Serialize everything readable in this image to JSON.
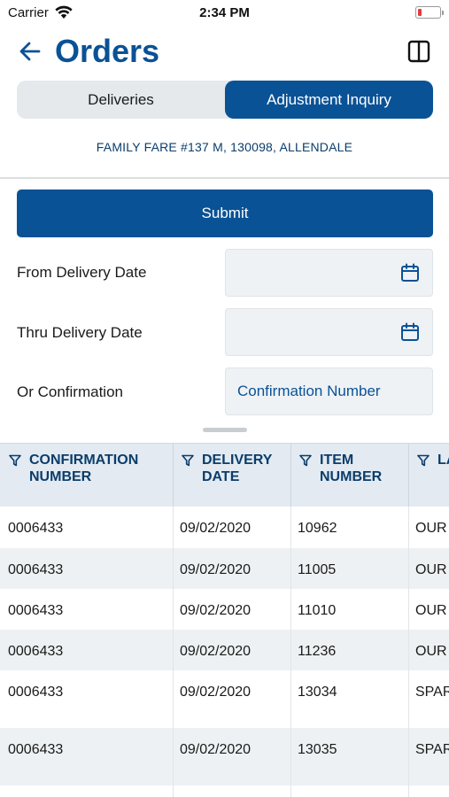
{
  "status_bar": {
    "carrier": "Carrier",
    "time": "2:34 PM"
  },
  "header": {
    "title": "Orders"
  },
  "tabs": [
    {
      "label": "Deliveries",
      "selected": false
    },
    {
      "label": "Adjustment Inquiry",
      "selected": true
    }
  ],
  "store": "FAMILY FARE #137 M, 130098, ALLENDALE",
  "form": {
    "submit_label": "Submit",
    "from_label": "From Delivery Date",
    "thru_label": "Thru Delivery Date",
    "confirmation_label": "Or Confirmation",
    "confirmation_placeholder": "Confirmation Number"
  },
  "table": {
    "columns": [
      "CONFIRMATION NUMBER",
      "DELIVERY DATE",
      "ITEM NUMBER",
      "LA"
    ],
    "column_lines": [
      [
        "CONFIRMATION",
        "NUMBER"
      ],
      [
        "DELIVERY",
        "DATE"
      ],
      [
        "ITEM",
        "NUMBER"
      ],
      [
        "LA",
        ""
      ]
    ],
    "rows": [
      [
        "0006433",
        "09/02/2020",
        "10962",
        "OUR"
      ],
      [
        "0006433",
        "09/02/2020",
        "11005",
        "OUR"
      ],
      [
        "0006433",
        "09/02/2020",
        "11010",
        "OUR"
      ],
      [
        "0006433",
        "09/02/2020",
        "11236",
        "OUR"
      ],
      [
        "0006433",
        "09/02/2020",
        "13034",
        "SPAR"
      ],
      [
        "0006433",
        "09/02/2020",
        "13035",
        "SPAR"
      ]
    ]
  },
  "colors": {
    "primary": "#0a5296",
    "segment_bg": "#e5e9ec",
    "header_bg": "#e3eaf1",
    "battery_low": "#e23c3c"
  }
}
